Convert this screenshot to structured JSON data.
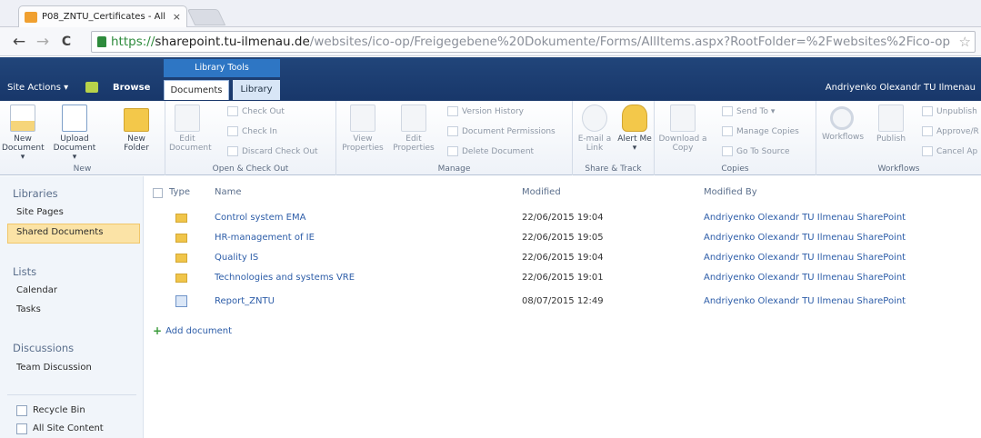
{
  "browser": {
    "tab_title": "P08_ZNTU_Certificates - All",
    "tab_close": "×",
    "back": "←",
    "forward": "→",
    "reload": "C",
    "url_scheme": "https://",
    "url_host": "sharepoint.tu-ilmenau.de",
    "url_path": "/websites/ico-op/Freigegebene%20Dokumente/Forms/AllItems.aspx?RootFolder=%2Fwebsites%2Fico-op",
    "star": "☆"
  },
  "sp_header": {
    "site_actions": "Site Actions ▾",
    "browse": "Browse",
    "library_tools": "Library Tools",
    "tab_documents": "Documents",
    "tab_library": "Library",
    "user": "Andriyenko Olexandr TU Ilmenau"
  },
  "ribbon": {
    "new": {
      "label": "New",
      "new_document": "New Document ▾",
      "upload_document": "Upload Document ▾",
      "new_folder": "New Folder"
    },
    "open_checkout": {
      "label": "Open & Check Out",
      "edit_document": "Edit Document",
      "check_out": "Check Out",
      "check_in": "Check In",
      "discard_check_out": "Discard Check Out"
    },
    "manage": {
      "label": "Manage",
      "view_properties": "View Properties",
      "edit_properties": "Edit Properties",
      "version_history": "Version History",
      "document_permissions": "Document Permissions",
      "delete_document": "Delete Document"
    },
    "share_track": {
      "label": "Share & Track",
      "email_link": "E-mail a Link",
      "alert_me": "Alert Me ▾"
    },
    "copies": {
      "label": "Copies",
      "download_copy": "Download a Copy",
      "send_to": "Send To ▾",
      "manage_copies": "Manage Copies",
      "go_to_source": "Go To Source"
    },
    "workflows": {
      "label": "Workflows",
      "workflows": "Workflows",
      "publish": "Publish",
      "unpublish": "Unpublish",
      "approve": "Approve/R",
      "cancel_approval": "Cancel Ap"
    }
  },
  "quick_launch": {
    "libraries": "Libraries",
    "site_pages": "Site Pages",
    "shared_documents": "Shared Documents",
    "lists": "Lists",
    "calendar": "Calendar",
    "tasks": "Tasks",
    "discussions": "Discussions",
    "team_discussion": "Team Discussion",
    "recycle_bin": "Recycle Bin",
    "all_site_content": "All Site Content"
  },
  "list": {
    "columns": {
      "type": "Type",
      "name": "Name",
      "modified": "Modified",
      "modified_by": "Modified By"
    },
    "rows": [
      {
        "type": "folder",
        "name": "Control system EMA",
        "modified": "22/06/2015 19:04",
        "modified_by": "Andriyenko Olexandr TU Ilmenau SharePoint"
      },
      {
        "type": "folder",
        "name": "HR-management of IE",
        "modified": "22/06/2015 19:05",
        "modified_by": "Andriyenko Olexandr TU Ilmenau SharePoint"
      },
      {
        "type": "folder",
        "name": "Quality IS",
        "modified": "22/06/2015 19:04",
        "modified_by": "Andriyenko Olexandr TU Ilmenau SharePoint"
      },
      {
        "type": "folder",
        "name": "Technologies and systems VRE",
        "modified": "22/06/2015 19:01",
        "modified_by": "Andriyenko Olexandr TU Ilmenau SharePoint"
      },
      {
        "type": "word-document",
        "name": "Report_ZNTU",
        "modified": "08/07/2015 12:49",
        "modified_by": "Andriyenko Olexandr TU Ilmenau SharePoint"
      }
    ],
    "add_document": "Add document"
  }
}
